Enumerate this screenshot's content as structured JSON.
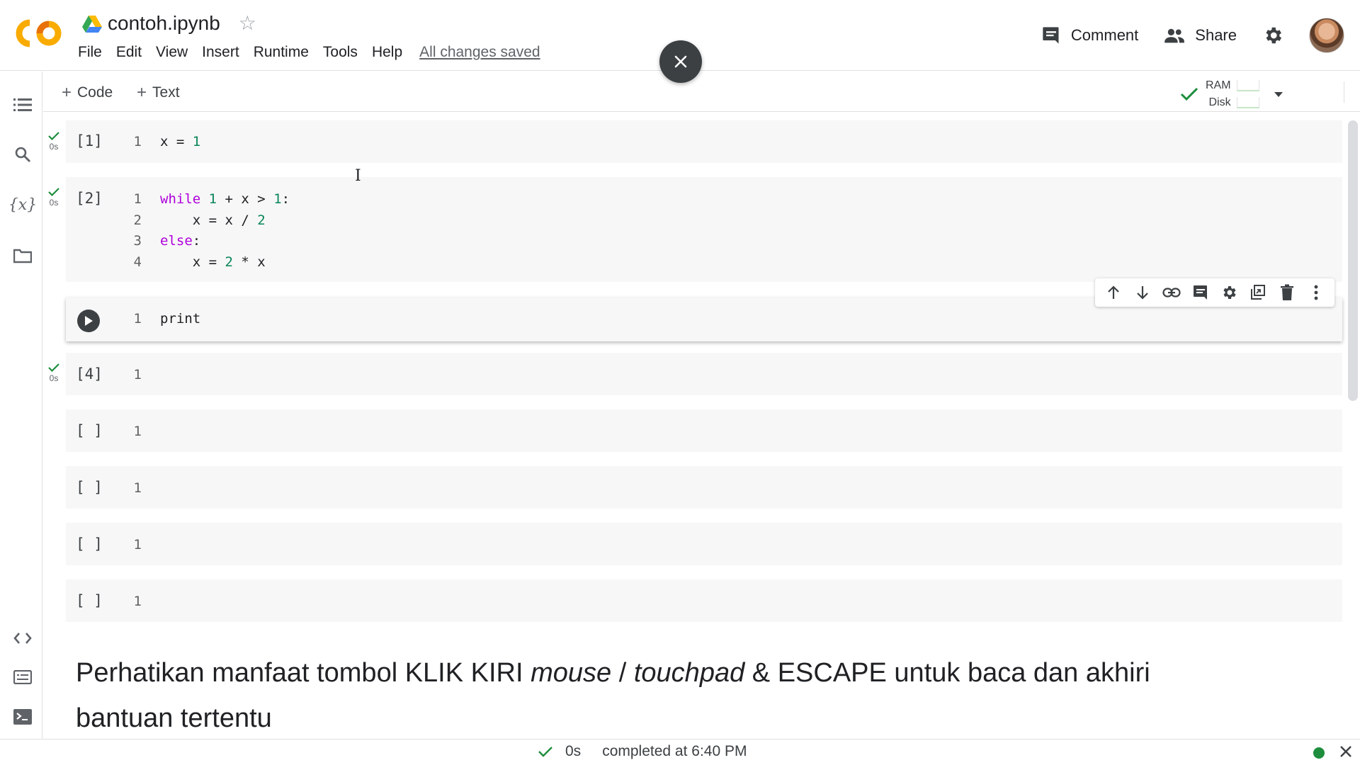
{
  "header": {
    "doc_title": "contoh.ipynb",
    "menu": [
      "File",
      "Edit",
      "View",
      "Insert",
      "Runtime",
      "Tools",
      "Help"
    ],
    "saved_status": "All changes saved",
    "comment_label": "Comment",
    "share_label": "Share"
  },
  "toolbar": {
    "add_code_label": "Code",
    "add_text_label": "Text",
    "ram_label": "RAM",
    "disk_label": "Disk"
  },
  "cells": [
    {
      "prompt": "[1]",
      "status_time": "0s",
      "lines": [
        "1"
      ],
      "code": "x = 1"
    },
    {
      "prompt": "[2]",
      "status_time": "0s",
      "lines": [
        "1",
        "2",
        "3",
        "4"
      ]
    },
    {
      "prompt": "",
      "lines": [
        "1"
      ],
      "code": "print"
    },
    {
      "prompt": "[4]",
      "status_time": "0s",
      "lines": [
        "1"
      ]
    },
    {
      "prompt": "[ ]",
      "lines": [
        "1"
      ]
    },
    {
      "prompt": "[ ]",
      "lines": [
        "1"
      ]
    },
    {
      "prompt": "[ ]",
      "lines": [
        "1"
      ]
    },
    {
      "prompt": "[ ]",
      "lines": [
        "1"
      ]
    }
  ],
  "code2": {
    "l1_kw": "while",
    "l1_a": " ",
    "l1_n1": "1",
    "l1_b": " + x > ",
    "l1_n2": "1",
    "l1_c": ":",
    "l2_a": "    x = x / ",
    "l2_n": "2",
    "l3_kw": "else",
    "l3_c": ":",
    "l4_a": "    x = ",
    "l4_n": "2",
    "l4_b": " * x"
  },
  "code1": {
    "a": "x = ",
    "n": "1"
  },
  "text_cell": {
    "p1": "Perhatikan manfaat tombol KLIK KIRI ",
    "em1": "mouse",
    "p2": " / ",
    "em2": "touchpad",
    "p3": " & ESCAPE untuk baca dan akhiri bantuan tertentu"
  },
  "statusbar": {
    "time": "0s",
    "message": "completed at 6:40 PM"
  },
  "colors": {
    "accent_orange": "#F9AB00",
    "ok_green": "#1E8E3E",
    "keyword_purple": "#AF00DB",
    "number_green": "#098658"
  },
  "icons": {
    "sidebar": [
      "table-of-contents-icon",
      "search-icon",
      "variables-icon",
      "folder-icon",
      "code-snippets-icon",
      "command-palette-icon",
      "terminal-icon"
    ],
    "cell_toolbar": [
      "move-up-icon",
      "move-down-icon",
      "link-icon",
      "comment-icon",
      "settings-icon",
      "mirror-cell-icon",
      "delete-icon",
      "more-vert-icon"
    ]
  }
}
